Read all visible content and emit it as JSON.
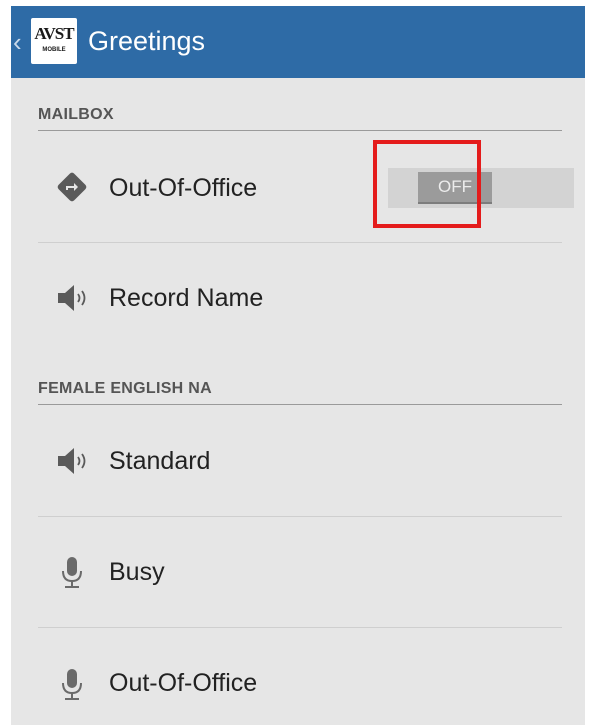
{
  "actionbar": {
    "back_glyph": "‹",
    "logo_text": "AVST",
    "logo_subtext": "MOBILE",
    "title": "Greetings"
  },
  "sections": {
    "mailbox": {
      "header": "MAILBOX",
      "items": [
        {
          "label": "Out-Of-Office",
          "icon": "directions-icon",
          "toggle": {
            "state": "OFF"
          }
        },
        {
          "label": "Record Name",
          "icon": "speaker-icon"
        }
      ]
    },
    "voice": {
      "header": "FEMALE ENGLISH NA",
      "items": [
        {
          "label": "Standard",
          "icon": "speaker-icon"
        },
        {
          "label": "Busy",
          "icon": "microphone-icon"
        },
        {
          "label": "Out-Of-Office",
          "icon": "microphone-icon"
        }
      ]
    }
  },
  "colors": {
    "actionbar": "#2e6ba6",
    "background": "#e6e6e6",
    "highlight": "#e41b1b"
  }
}
